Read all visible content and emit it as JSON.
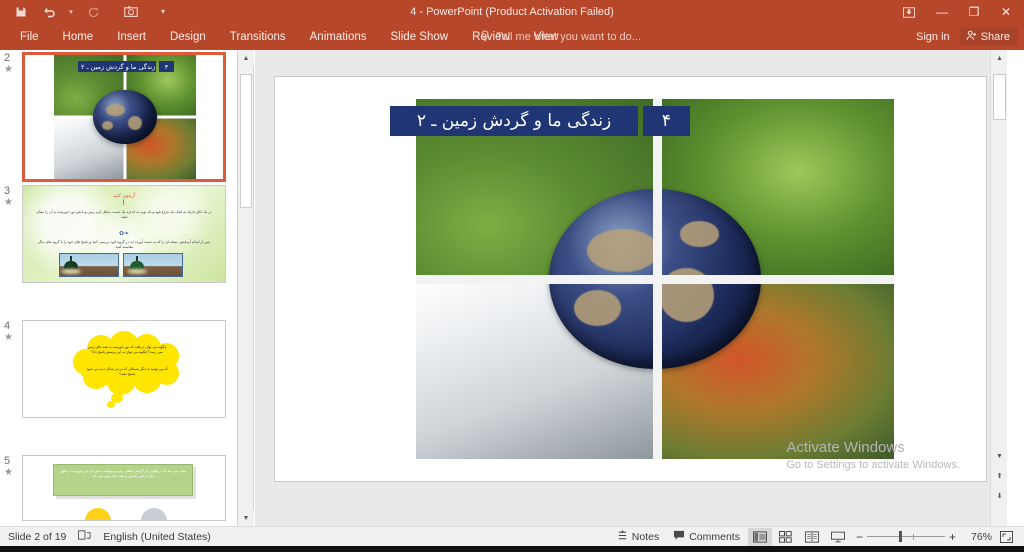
{
  "titlebar": {
    "window_title": "4 - PowerPoint (Product Activation Failed)",
    "quick_access": [
      {
        "name": "save-icon",
        "label": "Save"
      },
      {
        "name": "undo-icon",
        "label": "Undo"
      },
      {
        "name": "undo-dropdown-icon",
        "label": "▾"
      },
      {
        "name": "redo-icon",
        "label": "Redo"
      },
      {
        "name": "start-from-beginning-icon",
        "label": "Start From Beginning"
      },
      {
        "name": "customize-qat-icon",
        "label": "▾"
      }
    ],
    "window_controls": {
      "ribbon_display_options": "⊡",
      "minimize": "—",
      "restore": "❐",
      "close": "✕"
    }
  },
  "ribbon": {
    "tabs": [
      {
        "label": "File"
      },
      {
        "label": "Home"
      },
      {
        "label": "Insert"
      },
      {
        "label": "Design"
      },
      {
        "label": "Transitions"
      },
      {
        "label": "Animations"
      },
      {
        "label": "Slide Show"
      },
      {
        "label": "Review"
      },
      {
        "label": "View"
      }
    ],
    "tell_me_placeholder": "Tell me what you want to do...",
    "sign_in_label": "Sign in",
    "share_label": "Share"
  },
  "thumbnails": {
    "slides": [
      {
        "number": "2",
        "selected": true,
        "animation_marker": "★",
        "title_text": "زندگی ما و گردش زمین ـ ۲",
        "title_number": "۴"
      },
      {
        "number": "3",
        "selected": false,
        "animation_marker": "★",
        "heading": "آزمون کنید",
        "paragraph_1": "در یک اتاق تاریک به کمک یک چراغ قوه و یک توپ به اندازه یک دست، شکل کره زمین و تابش نور خورشید به آن را نشان دهید.",
        "paragraph_2": "پس از انجام آزمایش، نتیجه ای را که به دست آورده اید در گروه خود بررسی کنید و پاسخ های خود را با گروه های دیگر مقایسه کنید."
      },
      {
        "number": "4",
        "selected": false,
        "animation_marker": "★",
        "bubble_text_1": "چگونه می توان دریافت که نور خورشید به همه جای زمین نمی رسد؟ چگونه می توان به این پرسش پاسخ داد؟",
        "bubble_text_2": "آیا می توانید به دیگر مسائلی که در این شکل دیده می شود پاسخ دهید؟"
      },
      {
        "number": "5",
        "selected": false,
        "animation_marker": "★",
        "green_box_text": "نشان می دهد که در واقع بر اثر گردش انتقالی زمین و موقعیت محور آن، نور خورشید در طول سال به طور یکسان بر همه جای زمین نمی تابد."
      }
    ]
  },
  "slide_view": {
    "title_text": "زندگی ما و گردش زمین ـ ۲",
    "title_number": "۴",
    "photo_description": "four-seasons-earth-collage"
  },
  "activation_watermark": {
    "line1": "Activate Windows",
    "line2": "Go to Settings to activate Windows."
  },
  "statusbar": {
    "slide_indicator": "Slide 2 of 19",
    "accessibility_icon": "accessibility-checker-icon",
    "language": "English (United States)",
    "notes_label": "Notes",
    "comments_label": "Comments",
    "views": [
      {
        "name": "normal-view-icon",
        "active": true
      },
      {
        "name": "slide-sorter-view-icon",
        "active": false
      },
      {
        "name": "reading-view-icon",
        "active": false
      },
      {
        "name": "slide-show-view-icon",
        "active": false
      }
    ],
    "zoom_out": "−",
    "zoom_in": "+",
    "zoom_percent": "76%",
    "fit_to_window": "fit-slide-to-window-icon"
  },
  "colors": {
    "accent": "#b7472a",
    "accent_dark": "#a8432a",
    "selection": "#e05a3a",
    "slide_title_blue": "#1f3574",
    "statusbar_bg": "#f1f1f1"
  }
}
